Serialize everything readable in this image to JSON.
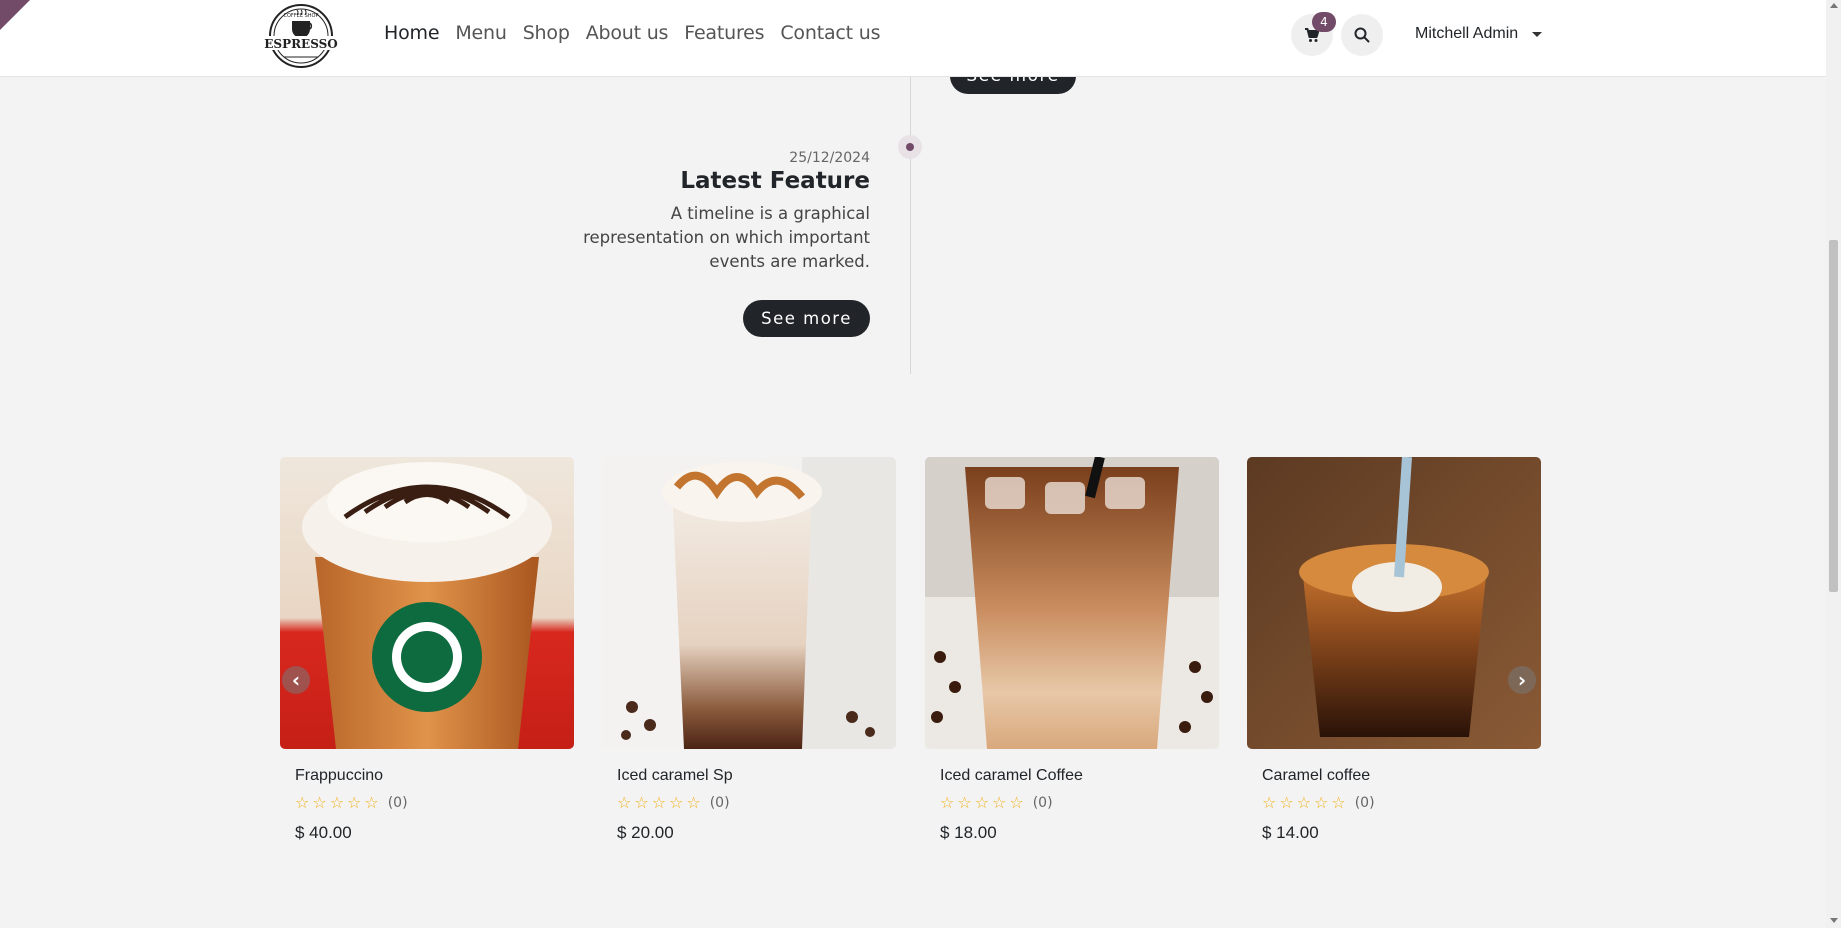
{
  "header": {
    "logo_top_text": "COFFEE SHOP",
    "logo_brand": "ESPRESSO",
    "nav": [
      {
        "label": "Home",
        "active": true
      },
      {
        "label": "Menu",
        "active": false
      },
      {
        "label": "Shop",
        "active": false
      },
      {
        "label": "About us",
        "active": false
      },
      {
        "label": "Features",
        "active": false
      },
      {
        "label": "Contact us",
        "active": false
      }
    ],
    "cart_count": "4",
    "user_name": "Mitchell Admin"
  },
  "timeline": {
    "prev_button_label": "See more",
    "entry": {
      "date": "25/12/2024",
      "title": "Latest Feature",
      "text": "A timeline is a graphical representation on which important events are marked.",
      "button_label": "See more"
    }
  },
  "products": [
    {
      "name": "Frappuccino",
      "rating_count": "(0)",
      "price": "$ 40.00"
    },
    {
      "name": "Iced caramel Sp",
      "rating_count": "(0)",
      "price": "$ 20.00"
    },
    {
      "name": "Iced caramel Coffee",
      "rating_count": "(0)",
      "price": "$ 18.00"
    },
    {
      "name": "Caramel coffee",
      "rating_count": "(0)",
      "price": "$ 14.00"
    }
  ],
  "colors": {
    "accent": "#714b67",
    "button_dark": "#212529",
    "star": "#f3b11b"
  }
}
